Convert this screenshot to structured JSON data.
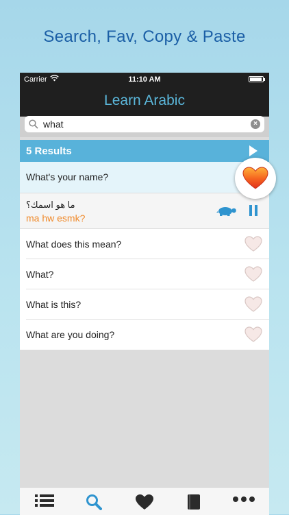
{
  "headline": "Search, Fav, Copy & Paste",
  "status": {
    "carrier": "Carrier",
    "time": "11:10 AM"
  },
  "nav": {
    "title": "Learn Arabic"
  },
  "search": {
    "value": "what",
    "placeholder": ""
  },
  "results": {
    "label": "5 Results"
  },
  "rows": [
    {
      "text": "What's your name?",
      "favorite": true
    },
    {
      "text": "What does this mean?",
      "favorite": false
    },
    {
      "text": "What?",
      "favorite": false
    },
    {
      "text": "What is this?",
      "favorite": false
    },
    {
      "text": "What are you doing?",
      "favorite": false
    }
  ],
  "detail": {
    "arabic": "ما هو اسمك؟",
    "transliteration": "ma hw esmk?"
  },
  "colors": {
    "accent": "#58b2da",
    "nav_title": "#5bb7db",
    "heart": "#f04a1c",
    "transliteration": "#f08a2b"
  },
  "tabs": [
    {
      "icon": "list-icon"
    },
    {
      "icon": "search-icon"
    },
    {
      "icon": "heart-icon"
    },
    {
      "icon": "book-icon"
    },
    {
      "icon": "more-icon"
    }
  ]
}
